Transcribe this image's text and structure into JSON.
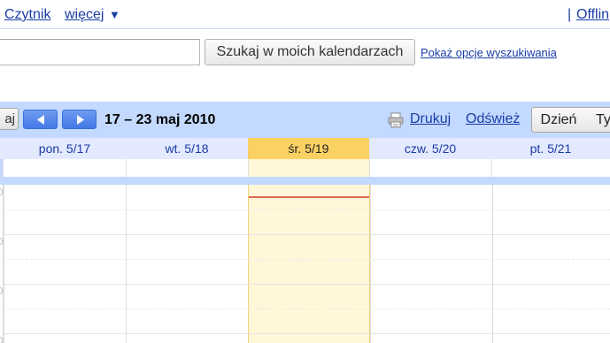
{
  "topbar": {
    "reader_link": "Czytnik",
    "more_link": "więcej",
    "more_arrow": "▼",
    "separator": "|",
    "offline_link": "Offlin"
  },
  "search": {
    "input_value": "",
    "button_label": "Szukaj w moich kalendarzach",
    "options_link": "Pokaż opcje wyszukiwania"
  },
  "toolbar": {
    "today_button": "aj",
    "prev_icon": "triangle-left-icon",
    "next_icon": "triangle-right-icon",
    "date_range": "17 – 23 maj 2010",
    "print_icon": "printer-icon",
    "print_link": "Drukuj",
    "refresh_link": "Odśwież",
    "view_day": "Dzień",
    "view_week": "Ty"
  },
  "days": [
    {
      "label": "pon. 5/17",
      "today": false
    },
    {
      "label": "wt. 5/18",
      "today": false
    },
    {
      "label": "śr. 5/19",
      "today": true
    },
    {
      "label": "czw. 5/20",
      "today": false
    },
    {
      "label": "pt. 5/21",
      "today": false
    }
  ],
  "colors": {
    "accent": "#c3d9ff",
    "link": "#1a3ca6",
    "today_header": "#fad163",
    "today_column": "#fff7d7",
    "now_indicator": "#dd6655",
    "nav_button": "#4f82ea"
  }
}
